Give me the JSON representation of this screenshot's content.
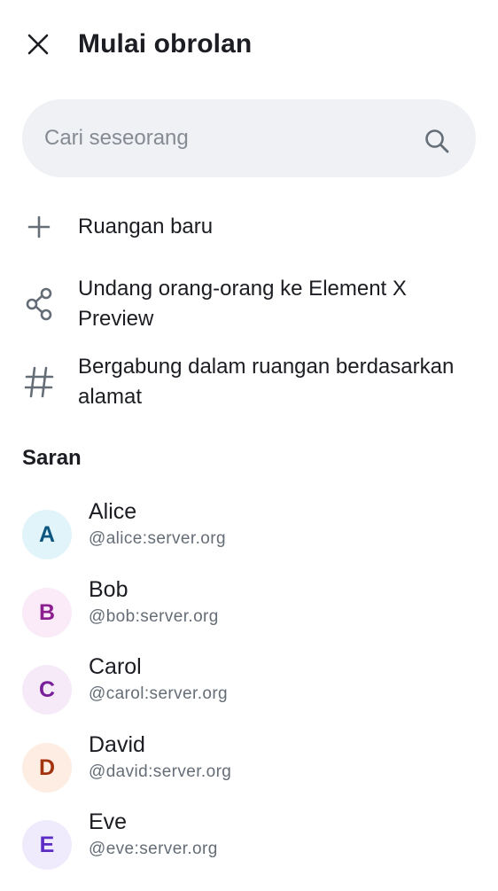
{
  "header": {
    "close_icon": "close-icon",
    "title": "Mulai obrolan"
  },
  "search": {
    "placeholder": "Cari seseorang",
    "value": "",
    "icon": "search-icon"
  },
  "actions": [
    {
      "label": "Ruangan baru",
      "icon": "plus-icon"
    },
    {
      "label": "Undang orang-orang ke Element X Preview",
      "icon": "share-icon"
    },
    {
      "label": "Bergabung dalam ruangan berdasarkan alamat",
      "icon": "hash-icon"
    }
  ],
  "suggestions": {
    "title": "Saran",
    "users": [
      {
        "initial": "A",
        "name": "Alice",
        "id": "@alice:server.org",
        "bg": "#e0f4f9",
        "fg": "#0c5680"
      },
      {
        "initial": "B",
        "name": "Bob",
        "id": "@bob:server.org",
        "bg": "#fbeaf8",
        "fg": "#8b1f8f"
      },
      {
        "initial": "C",
        "name": "Carol",
        "id": "@carol:server.org",
        "bg": "#f6eaf9",
        "fg": "#7a1f9a"
      },
      {
        "initial": "D",
        "name": "David",
        "id": "@david:server.org",
        "bg": "#fdede3",
        "fg": "#a3330e"
      },
      {
        "initial": "E",
        "name": "Eve",
        "id": "@eve:server.org",
        "bg": "#efebfc",
        "fg": "#5b2bc4"
      }
    ]
  },
  "colors": {
    "icon": "#656d77",
    "search_bg": "#eff1f5",
    "text_primary": "#1b1d22",
    "text_secondary": "#656d77"
  }
}
